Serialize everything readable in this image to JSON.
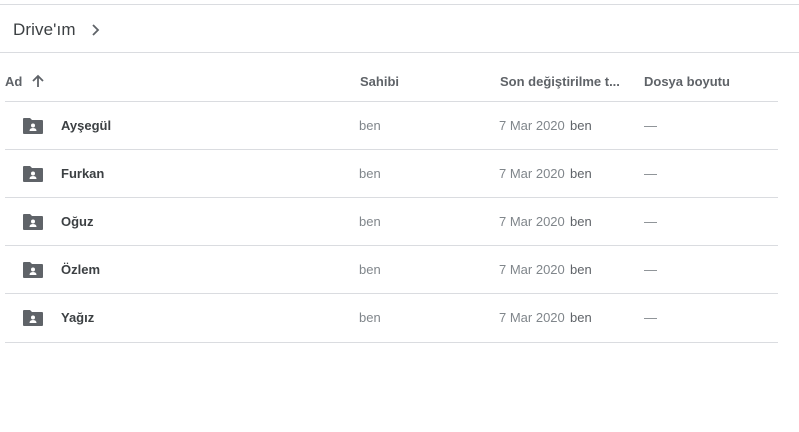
{
  "breadcrumb": {
    "label": "Drive'ım"
  },
  "columns": {
    "name": "Ad",
    "owner": "Sahibi",
    "modified": "Son değiştirilme t...",
    "size": "Dosya boyutu"
  },
  "sort": {
    "column": "name",
    "direction": "ascending",
    "icon": "arrow-up-icon"
  },
  "folder_icon": "shared-folder-icon",
  "rows": [
    {
      "name": "Ayşegül",
      "owner": "ben",
      "date": "7 Mar 2020",
      "modifier": "ben",
      "size": "—"
    },
    {
      "name": "Furkan",
      "owner": "ben",
      "date": "7 Mar 2020",
      "modifier": "ben",
      "size": "—"
    },
    {
      "name": "Oğuz",
      "owner": "ben",
      "date": "7 Mar 2020",
      "modifier": "ben",
      "size": "—"
    },
    {
      "name": "Özlem",
      "owner": "ben",
      "date": "7 Mar 2020",
      "modifier": "ben",
      "size": "—"
    },
    {
      "name": "Yağız",
      "owner": "ben",
      "date": "7 Mar 2020",
      "modifier": "ben",
      "size": "—"
    }
  ]
}
